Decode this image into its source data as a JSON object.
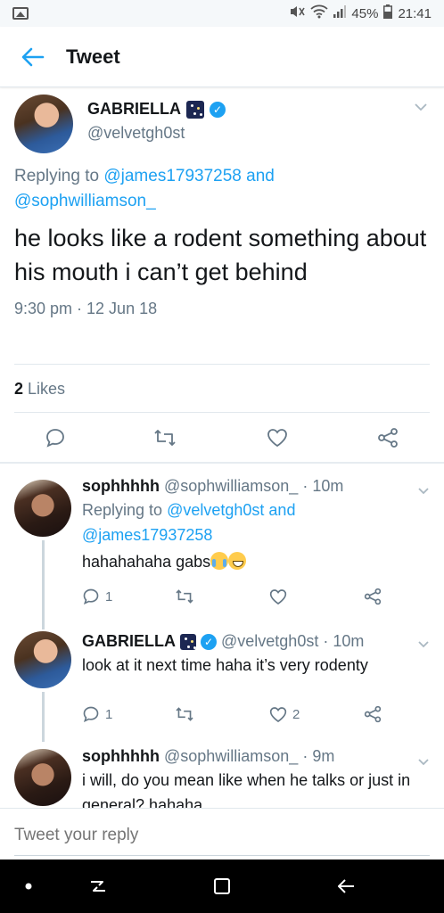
{
  "status_bar": {
    "battery": "45%",
    "time": "21:41"
  },
  "header": {
    "title": "Tweet"
  },
  "main_tweet": {
    "display_name": "GABRIELLA",
    "handle": "@velvetgh0st",
    "replying_prefix": "Replying to",
    "replying_user1": "@james17937258",
    "replying_and": "and",
    "replying_user2": "@sophwilliamson_",
    "text": "he looks like a rodent something about his mouth i can’t get behind",
    "timestamp": "9:30 pm · 12 Jun 18",
    "likes_count": "2",
    "likes_label": "Likes"
  },
  "replies": [
    {
      "name": "sophhhhh",
      "handle": "@sophwilliamson_",
      "time": "· 10m",
      "replying_prefix": "Replying to",
      "replying_user1": "@velvetgh0st",
      "replying_and": "and",
      "replying_user2": "@james17937258",
      "text": "hahahahaha gabs",
      "reply_count": "1",
      "like_count": ""
    },
    {
      "name": "GABRIELLA",
      "handle": "@velvetgh0st",
      "time": "· 10m",
      "text": "look at it next time haha it’s very rodenty",
      "reply_count": "1",
      "like_count": "2"
    },
    {
      "name": "sophhhhh",
      "handle": "@sophwilliamson_",
      "time": "· 9m",
      "text": "i will, do you mean like when he talks or just in general? hahaha"
    }
  ],
  "compose": {
    "placeholder": "Tweet your reply"
  },
  "colors": {
    "accent": "#1da1f2",
    "secondary_text": "#657786",
    "divider": "#e1e8ed"
  }
}
